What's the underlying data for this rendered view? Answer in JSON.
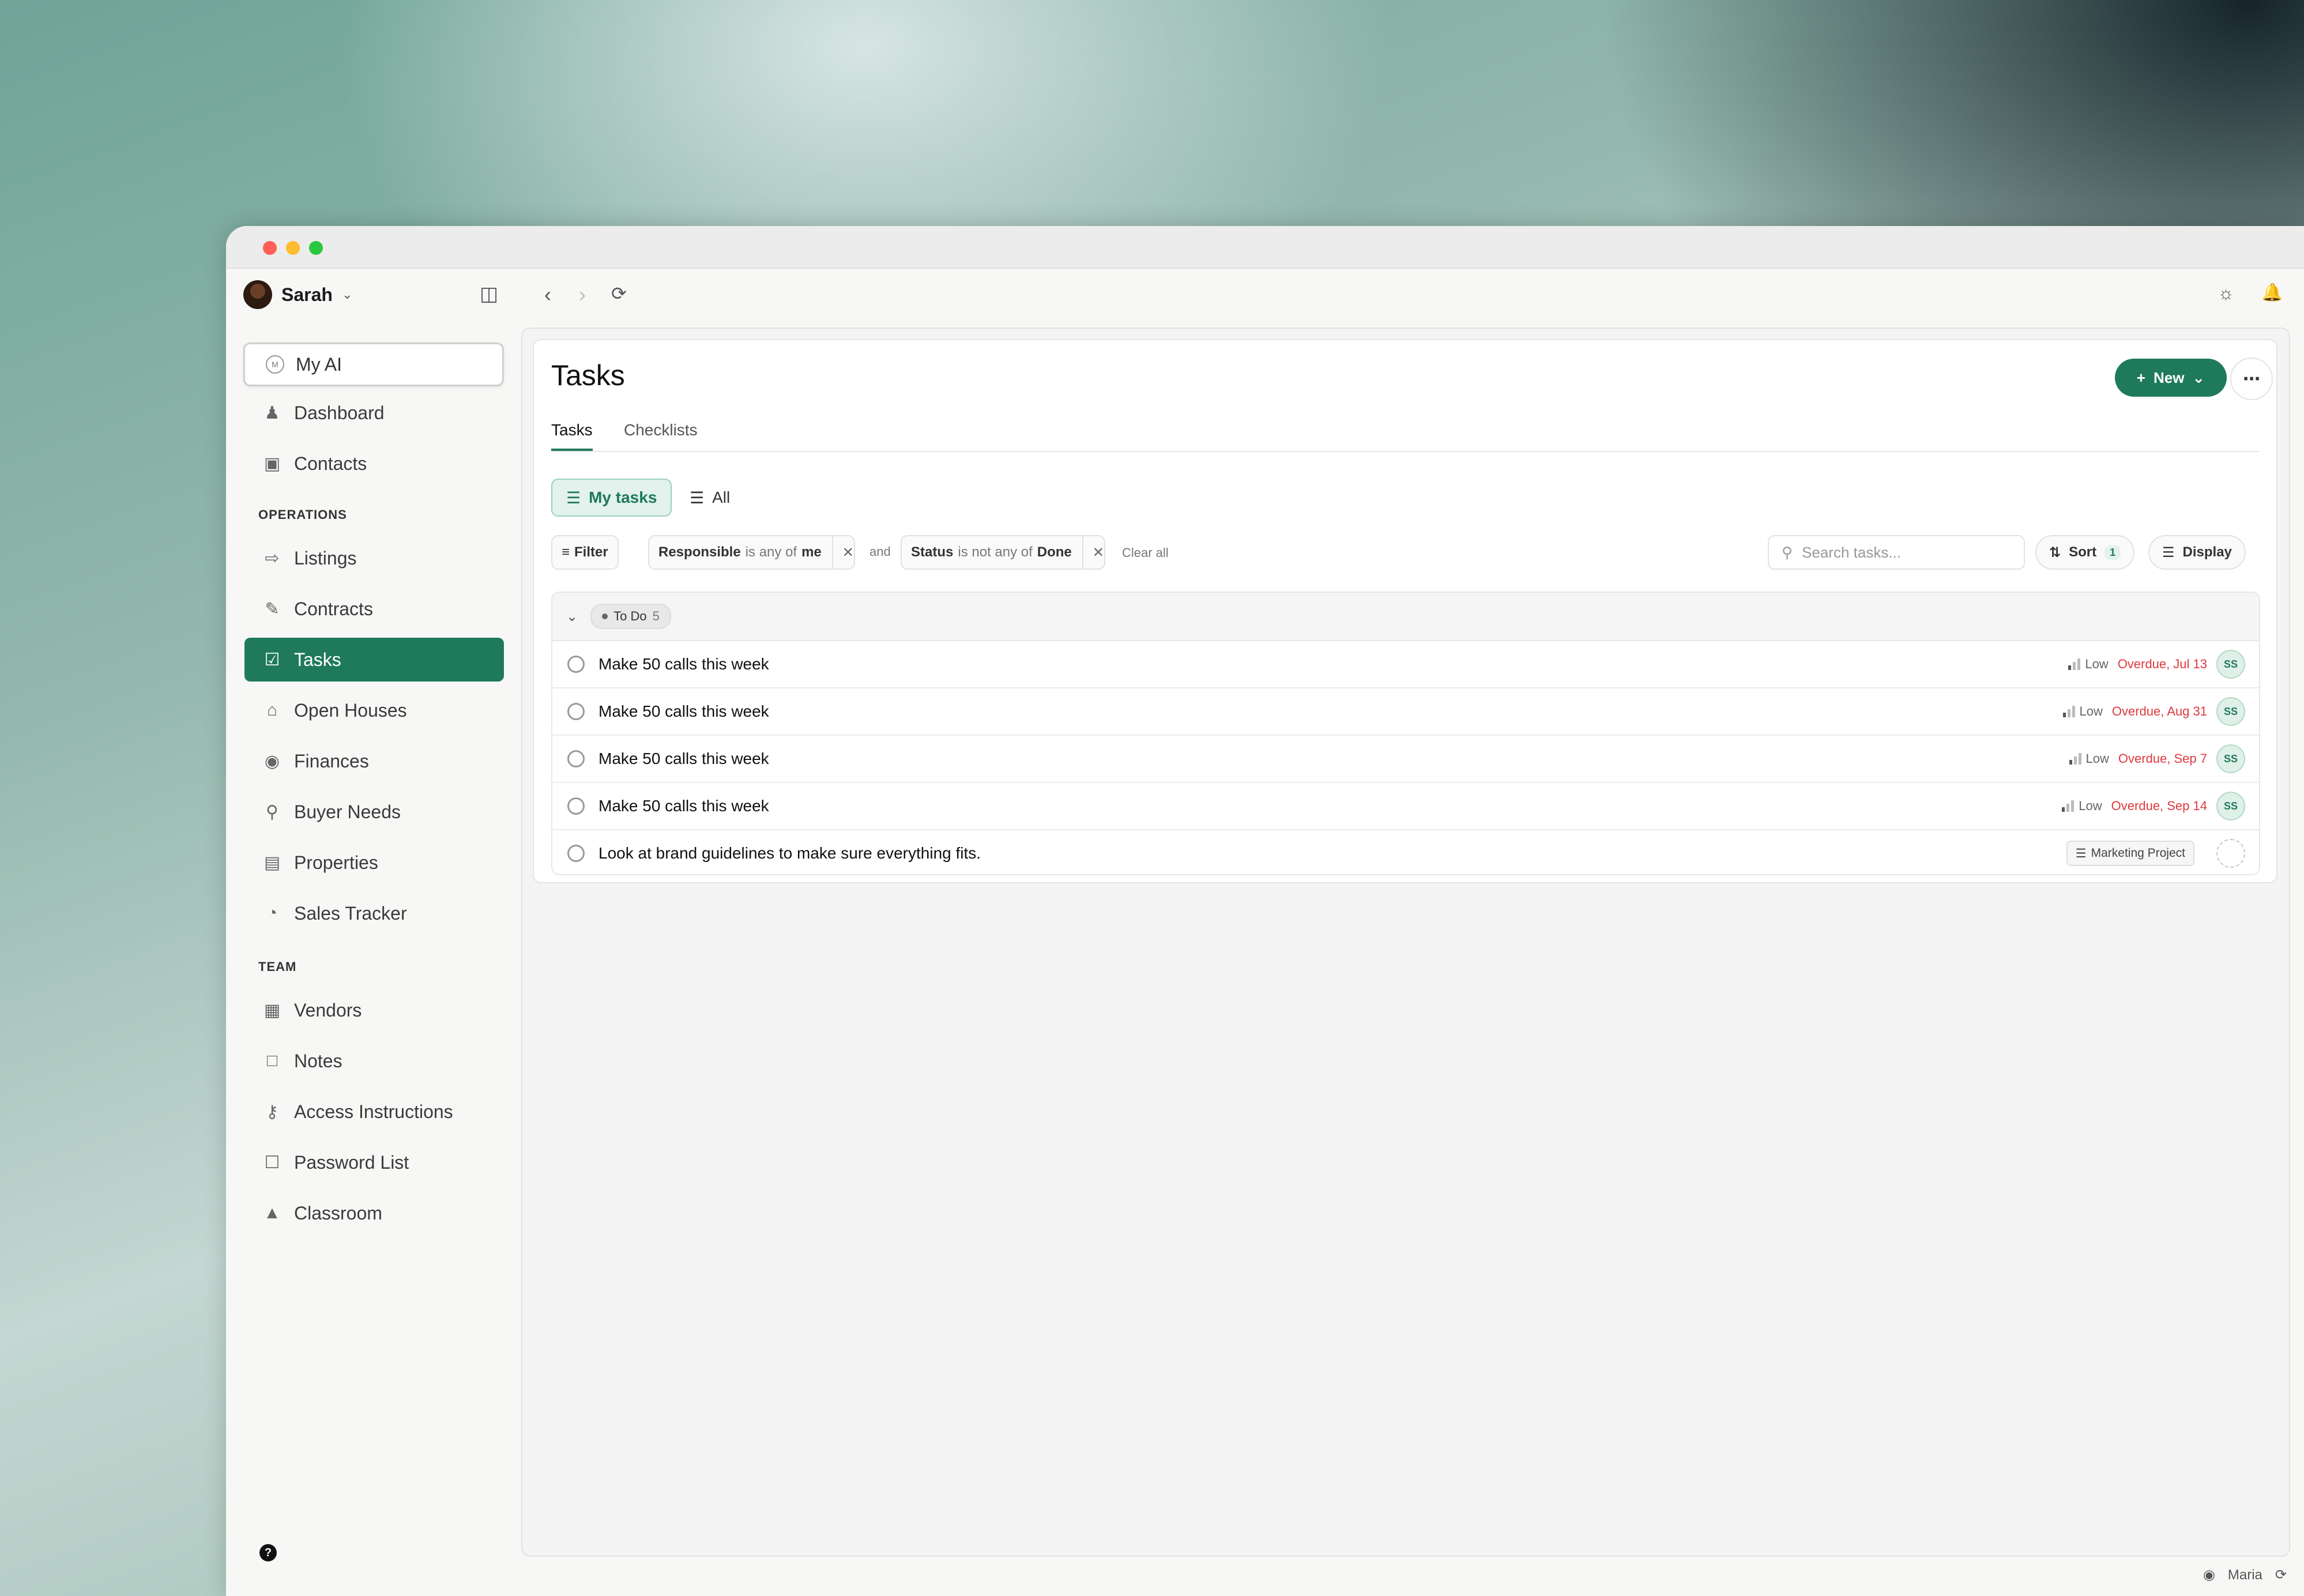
{
  "user": {
    "name": "Sarah"
  },
  "sidebar": {
    "my_ai": "My AI",
    "items_top": [
      {
        "label": "Dashboard",
        "icon": "users-icon"
      },
      {
        "label": "Contacts",
        "icon": "contact-card-icon"
      }
    ],
    "operations_label": "OPERATIONS",
    "operations": [
      {
        "label": "Listings",
        "icon": "sign-in-icon"
      },
      {
        "label": "Contracts",
        "icon": "file-edit-icon"
      },
      {
        "label": "Tasks",
        "icon": "clipboard-check-icon"
      },
      {
        "label": "Open Houses",
        "icon": "home-icon"
      },
      {
        "label": "Finances",
        "icon": "coins-icon"
      },
      {
        "label": "Buyer Needs",
        "icon": "lightbulb-icon"
      },
      {
        "label": "Properties",
        "icon": "file-key-icon"
      },
      {
        "label": "Sales Tracker",
        "icon": "gauge-icon"
      }
    ],
    "team_label": "TEAM",
    "team": [
      {
        "label": "Vendors",
        "icon": "contact-book-icon"
      },
      {
        "label": "Notes",
        "icon": "file-icon"
      },
      {
        "label": "Access Instructions",
        "icon": "key-icon"
      },
      {
        "label": "Password List",
        "icon": "lock-icon"
      },
      {
        "label": "Classroom",
        "icon": "graduation-cap-icon"
      }
    ],
    "help": "?"
  },
  "page": {
    "title": "Tasks",
    "new_label": "New",
    "tabs": [
      "Tasks",
      "Checklists"
    ],
    "views": [
      "My tasks",
      "All"
    ],
    "filter_label": "Filter",
    "filters": [
      {
        "field": "Responsible",
        "op": "is any of",
        "value": "me"
      },
      {
        "field": "Status",
        "op": "is not any of",
        "value": "Done"
      }
    ],
    "and_label": "and",
    "clear_all": "Clear all",
    "search_placeholder": "Search tasks...",
    "sort_label": "Sort",
    "sort_count": "1",
    "display_label": "Display"
  },
  "group": {
    "name": "To Do",
    "count": "5"
  },
  "tasks": [
    {
      "title": "Make 50 calls this week",
      "priority": "Low",
      "due": "Overdue, Jul 13",
      "assignee": "SS"
    },
    {
      "title": "Make 50 calls this week",
      "priority": "Low",
      "due": "Overdue, Aug 31",
      "assignee": "SS"
    },
    {
      "title": "Make 50 calls this week",
      "priority": "Low",
      "due": "Overdue, Sep 7",
      "assignee": "SS"
    },
    {
      "title": "Make 50 calls this week",
      "priority": "Low",
      "due": "Overdue, Sep 14",
      "assignee": "SS"
    },
    {
      "title": "Look at brand guidelines to make sure everything fits.",
      "project": "Marketing Project"
    }
  ],
  "footer": {
    "user": "Maria"
  },
  "colors": {
    "accent": "#1f7a5c",
    "overdue": "#e0393e"
  }
}
